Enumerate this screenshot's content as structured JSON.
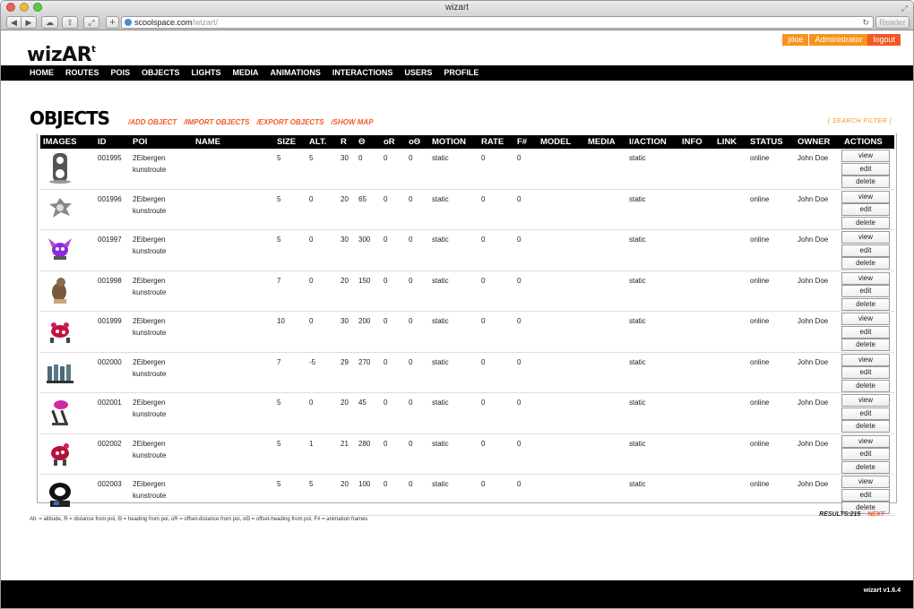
{
  "window": {
    "title": "wizart"
  },
  "browser": {
    "url_host": "scoolspace.com",
    "url_path": "/wizart/",
    "reader_label": "Reader",
    "plus_label": "+"
  },
  "site": {
    "logo": "wizAR",
    "logo_sup": "t",
    "user": {
      "name": "jdoe",
      "role": "Administrator",
      "logout": "logout"
    },
    "nav": [
      "HOME",
      "ROUTES",
      "POIS",
      "OBJECTS",
      "LIGHTS",
      "MEDIA",
      "ANIMATIONS",
      "INTERACTIONS",
      "USERS",
      "PROFILE"
    ]
  },
  "page": {
    "title": "OBJECTS",
    "links": [
      "/ADD OBJECT",
      "/IMPORT OBJECTS",
      "/EXPORT OBJECTS",
      "/SHOW MAP"
    ],
    "search_filter": "[ SEARCH FILTER ]"
  },
  "table": {
    "headers": [
      "IMAGES",
      "ID",
      "POI",
      "NAME",
      "SIZE",
      "ALT.",
      "R",
      "Θ",
      "oR",
      "oΘ",
      "MOTION",
      "RATE",
      "F#",
      "MODEL",
      "MEDIA",
      "I/ACTION",
      "INFO",
      "LINK",
      "STATUS",
      "OWNER",
      "ACTIONS"
    ],
    "action_labels": {
      "view": "view",
      "edit": "edit",
      "delete": "delete"
    },
    "rows": [
      {
        "thumb": "figure-eight-icon",
        "id": "001995",
        "poi": "2Eibergen kunstroute",
        "name": "",
        "size": "5",
        "alt": "5",
        "r": "30",
        "theta": "0",
        "or": "0",
        "otheta": "0",
        "motion": "static",
        "rate": "0",
        "frames": "0",
        "iaction": "static",
        "status": "online",
        "owner": "John Doe"
      },
      {
        "thumb": "gear-creature-icon",
        "id": "001996",
        "poi": "2Eibergen kunstroute",
        "name": "",
        "size": "5",
        "alt": "0",
        "r": "20",
        "theta": "65",
        "or": "0",
        "otheta": "0",
        "motion": "static",
        "rate": "0",
        "frames": "0",
        "iaction": "static",
        "status": "online",
        "owner": "John Doe"
      },
      {
        "thumb": "purple-bug-icon",
        "id": "001997",
        "poi": "2Eibergen kunstroute",
        "name": "",
        "size": "5",
        "alt": "0",
        "r": "30",
        "theta": "300",
        "or": "0",
        "otheta": "0",
        "motion": "static",
        "rate": "0",
        "frames": "0",
        "iaction": "static",
        "status": "online",
        "owner": "John Doe"
      },
      {
        "thumb": "brown-animal-icon",
        "id": "001998",
        "poi": "2Eibergen kunstroute",
        "name": "",
        "size": "7",
        "alt": "0",
        "r": "20",
        "theta": "150",
        "or": "0",
        "otheta": "0",
        "motion": "static",
        "rate": "0",
        "frames": "0",
        "iaction": "static",
        "status": "online",
        "owner": "John Doe"
      },
      {
        "thumb": "red-creature-icon",
        "id": "001999",
        "poi": "2Eibergen kunstroute",
        "name": "",
        "size": "10",
        "alt": "0",
        "r": "30",
        "theta": "200",
        "or": "0",
        "otheta": "0",
        "motion": "static",
        "rate": "0",
        "frames": "0",
        "iaction": "static",
        "status": "online",
        "owner": "John Doe"
      },
      {
        "thumb": "figure-group-icon",
        "id": "002000",
        "poi": "2Eibergen kunstroute",
        "name": "",
        "size": "7",
        "alt": "-5",
        "r": "29",
        "theta": "270",
        "or": "0",
        "otheta": "0",
        "motion": "static",
        "rate": "0",
        "frames": "0",
        "iaction": "static",
        "status": "online",
        "owner": "John Doe"
      },
      {
        "thumb": "pink-walker-icon",
        "id": "002001",
        "poi": "2Eibergen kunstroute",
        "name": "",
        "size": "5",
        "alt": "0",
        "r": "20",
        "theta": "45",
        "or": "0",
        "otheta": "0",
        "motion": "static",
        "rate": "0",
        "frames": "0",
        "iaction": "static",
        "status": "online",
        "owner": "John Doe"
      },
      {
        "thumb": "red-creature-2-icon",
        "id": "002002",
        "poi": "2Eibergen kunstroute",
        "name": "",
        "size": "5",
        "alt": "1",
        "r": "21",
        "theta": "280",
        "or": "0",
        "otheta": "0",
        "motion": "static",
        "rate": "0",
        "frames": "0",
        "iaction": "static",
        "status": "online",
        "owner": "John Doe"
      },
      {
        "thumb": "dark-helmet-icon",
        "id": "002003",
        "poi": "2Eibergen kunstroute",
        "name": "",
        "size": "5",
        "alt": "5",
        "r": "20",
        "theta": "100",
        "or": "0",
        "otheta": "0",
        "motion": "static",
        "rate": "0",
        "frames": "0",
        "iaction": "static",
        "status": "online",
        "owner": "John Doe"
      }
    ]
  },
  "footnote": "Alt. = altitude, R = distance from poi, Θ = heading from poi, oR = offset-distance from poi, oΘ = offset-heading from poi, F# = animation frames",
  "results": {
    "label": "RESULTS:215",
    "next": "NEXT"
  },
  "footer": {
    "version": "wizart v1.6.4"
  }
}
